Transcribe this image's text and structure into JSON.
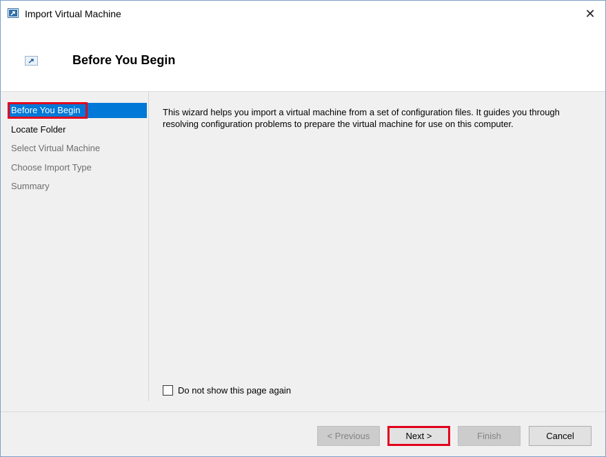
{
  "window": {
    "title": "Import Virtual Machine",
    "close_glyph": "✕",
    "app_icon": "import-vm-icon"
  },
  "header": {
    "title": "Before You Begin",
    "icon": "import-vm-icon"
  },
  "nav": {
    "items": [
      {
        "label": "Before You Begin",
        "state": "selected"
      },
      {
        "label": "Locate Folder",
        "state": "enabled"
      },
      {
        "label": "Select Virtual Machine",
        "state": "disabled"
      },
      {
        "label": "Choose Import Type",
        "state": "disabled"
      },
      {
        "label": "Summary",
        "state": "disabled"
      }
    ]
  },
  "content": {
    "description": "This wizard helps you import a virtual machine from a set of configuration files. It guides you through resolving configuration problems to prepare the virtual machine for use on this computer.",
    "checkbox_label": "Do not show this page again",
    "checkbox_checked": false
  },
  "buttons": {
    "previous": "< Previous",
    "next": "Next >",
    "finish": "Finish",
    "cancel": "Cancel"
  },
  "colors": {
    "selection": "#0078d7",
    "highlight_annotation": "#e3001b"
  }
}
